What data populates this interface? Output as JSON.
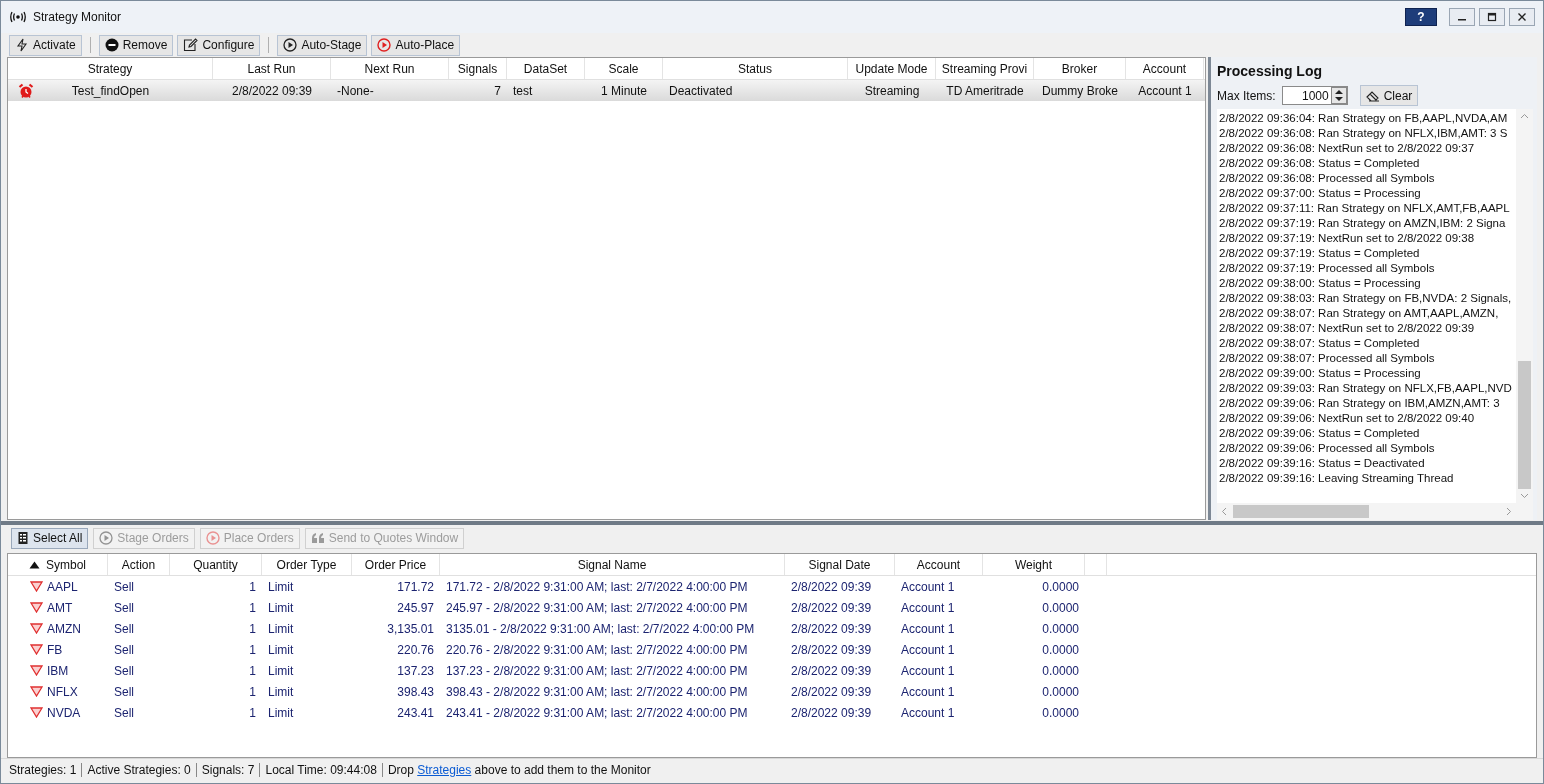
{
  "window": {
    "title": "Strategy Monitor",
    "help_button": "?"
  },
  "toolbar": {
    "groups": [
      {
        "buttons": [
          {
            "label": "Activate",
            "kind": "activate"
          }
        ]
      },
      {
        "buttons": [
          {
            "label": "Remove",
            "kind": "remove"
          },
          {
            "label": "Configure",
            "kind": "configure"
          }
        ]
      },
      {
        "buttons": [
          {
            "label": "Auto-Stage",
            "kind": "stage"
          },
          {
            "label": "Auto-Place",
            "kind": "place"
          }
        ]
      }
    ]
  },
  "strategies": {
    "columns": [
      "Strategy",
      "Last Run",
      "Next Run",
      "Signals",
      "DataSet",
      "Scale",
      "Status",
      "Update Mode",
      "Streaming Provi",
      "Broker",
      "Account"
    ],
    "rows": [
      {
        "selected": true,
        "cells": [
          "Test_findOpen",
          "2/8/2022 09:39",
          "-None-",
          "7",
          "test",
          "1 Minute",
          "Deactivated",
          "Streaming",
          "TD Ameritrade",
          "Dummy Broke",
          "Account 1"
        ]
      }
    ]
  },
  "log": {
    "title": "Processing Log",
    "max_items_label": "Max Items:",
    "max_items": "1000",
    "clear_button": "Clear",
    "lines": [
      "2/8/2022 09:36:04: Ran Strategy on FB,AAPL,NVDA,AM",
      "2/8/2022 09:36:08: Ran Strategy on NFLX,IBM,AMT: 3 S",
      "2/8/2022 09:36:08: NextRun set to 2/8/2022 09:37",
      "2/8/2022 09:36:08: Status = Completed",
      "2/8/2022 09:36:08: Processed all Symbols",
      "2/8/2022 09:37:00: Status = Processing",
      "2/8/2022 09:37:11: Ran Strategy on NFLX,AMT,FB,AAPL",
      "2/8/2022 09:37:19: Ran Strategy on AMZN,IBM: 2 Signa",
      "2/8/2022 09:37:19: NextRun set to 2/8/2022 09:38",
      "2/8/2022 09:37:19: Status = Completed",
      "2/8/2022 09:37:19: Processed all Symbols",
      "2/8/2022 09:38:00: Status = Processing",
      "2/8/2022 09:38:03: Ran Strategy on FB,NVDA: 2 Signals,",
      "2/8/2022 09:38:07: Ran Strategy on AMT,AAPL,AMZN,",
      "2/8/2022 09:38:07: NextRun set to 2/8/2022 09:39",
      "2/8/2022 09:38:07: Status = Completed",
      "2/8/2022 09:38:07: Processed all Symbols",
      "2/8/2022 09:39:00: Status = Processing",
      "2/8/2022 09:39:03: Ran Strategy on NFLX,FB,AAPL,NVD",
      "2/8/2022 09:39:06: Ran Strategy on IBM,AMZN,AMT: 3",
      "2/8/2022 09:39:06: NextRun set to 2/8/2022 09:40",
      "2/8/2022 09:39:06: Status = Completed",
      "2/8/2022 09:39:06: Processed all Symbols",
      "2/8/2022 09:39:16: Status = Deactivated",
      "2/8/2022 09:39:16: Leaving Streaming Thread"
    ]
  },
  "orders_toolbar": {
    "buttons": [
      {
        "label": "Select All",
        "kind": "select",
        "disabled": false
      },
      {
        "label": "Stage Orders",
        "kind": "stage",
        "disabled": true
      },
      {
        "label": "Place Orders",
        "kind": "place",
        "disabled": true
      },
      {
        "label": "Send to Quotes Window",
        "kind": "quotes",
        "disabled": true
      }
    ]
  },
  "signals": {
    "columns": [
      {
        "label": "Symbol",
        "sorted": true
      },
      {
        "label": "Action",
        "sorted": false
      },
      {
        "label": "Quantity",
        "sorted": false
      },
      {
        "label": "Order Type",
        "sorted": false
      },
      {
        "label": "Order Price",
        "sorted": false
      },
      {
        "label": "Signal Name",
        "sorted": false
      },
      {
        "label": "Signal Date",
        "sorted": false
      },
      {
        "label": "Account",
        "sorted": false
      },
      {
        "label": "Weight",
        "sorted": false
      }
    ],
    "rows": [
      {
        "symbol": "AAPL",
        "action": "Sell",
        "quantity": "1",
        "order_type": "Limit",
        "order_price": "171.72",
        "signal_name": "171.72 - 2/8/2022 9:31:00 AM; last: 2/7/2022 4:00:00 PM",
        "signal_date": "2/8/2022 09:39",
        "account": "Account 1",
        "weight": "0.0000"
      },
      {
        "symbol": "AMT",
        "action": "Sell",
        "quantity": "1",
        "order_type": "Limit",
        "order_price": "245.97",
        "signal_name": "245.97 - 2/8/2022 9:31:00 AM; last: 2/7/2022 4:00:00 PM",
        "signal_date": "2/8/2022 09:39",
        "account": "Account 1",
        "weight": "0.0000"
      },
      {
        "symbol": "AMZN",
        "action": "Sell",
        "quantity": "1",
        "order_type": "Limit",
        "order_price": "3,135.01",
        "signal_name": "3135.01 - 2/8/2022 9:31:00 AM; last: 2/7/2022 4:00:00 PM",
        "signal_date": "2/8/2022 09:39",
        "account": "Account 1",
        "weight": "0.0000"
      },
      {
        "symbol": "FB",
        "action": "Sell",
        "quantity": "1",
        "order_type": "Limit",
        "order_price": "220.76",
        "signal_name": "220.76 - 2/8/2022 9:31:00 AM; last: 2/7/2022 4:00:00 PM",
        "signal_date": "2/8/2022 09:39",
        "account": "Account 1",
        "weight": "0.0000"
      },
      {
        "symbol": "IBM",
        "action": "Sell",
        "quantity": "1",
        "order_type": "Limit",
        "order_price": "137.23",
        "signal_name": "137.23 - 2/8/2022 9:31:00 AM; last: 2/7/2022 4:00:00 PM",
        "signal_date": "2/8/2022 09:39",
        "account": "Account 1",
        "weight": "0.0000"
      },
      {
        "symbol": "NFLX",
        "action": "Sell",
        "quantity": "1",
        "order_type": "Limit",
        "order_price": "398.43",
        "signal_name": "398.43 - 2/8/2022 9:31:00 AM; last: 2/7/2022 4:00:00 PM",
        "signal_date": "2/8/2022 09:39",
        "account": "Account 1",
        "weight": "0.0000"
      },
      {
        "symbol": "NVDA",
        "action": "Sell",
        "quantity": "1",
        "order_type": "Limit",
        "order_price": "243.41",
        "signal_name": "243.41 - 2/8/2022 9:31:00 AM; last: 2/7/2022 4:00:00 PM",
        "signal_date": "2/8/2022 09:39",
        "account": "Account 1",
        "weight": "0.0000"
      }
    ]
  },
  "status_bar": {
    "fields": [
      "Strategies: 1",
      "Active Strategies: 0",
      "Signals: 7",
      "Local Time: 09:44:08"
    ],
    "hint": {
      "before": "Drop",
      "link": "Strategies",
      "after": "above to add them to the Monitor"
    }
  }
}
